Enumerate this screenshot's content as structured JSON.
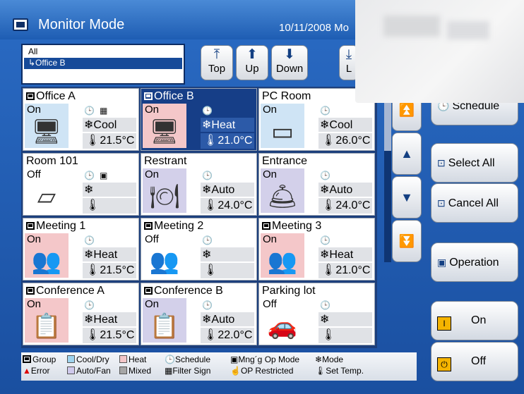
{
  "window": {
    "title": "Monitor Mode",
    "date": "10/11/2008 Mo"
  },
  "group_list": {
    "all": "All",
    "selected": "↳Office B"
  },
  "nav": {
    "top": "Top",
    "up": "Up",
    "down": "Down",
    "last": "L"
  },
  "units": [
    {
      "name": "Office A",
      "group": true,
      "status": "On",
      "status_color": "#cfe4f5",
      "art": "🖥",
      "schedule": "🕒",
      "filter": "▦",
      "mode": "Cool",
      "temp": "21.5°C",
      "selected": false
    },
    {
      "name": "Office B",
      "group": true,
      "status": "On",
      "status_color": "#f4c7c9",
      "art": "🖥",
      "schedule": "🕒",
      "filter": "",
      "mode": "Heat",
      "temp": "21.0°C",
      "selected": true
    },
    {
      "name": "PC Room",
      "group": false,
      "status": "On",
      "status_color": "#cfe4f5",
      "art": "▭",
      "schedule": "🕒",
      "filter": "",
      "mode": "Cool",
      "temp": "26.0°C",
      "selected": false
    },
    {
      "name": "Room 101",
      "group": false,
      "status": "Off",
      "status_color": "#ffffff",
      "art": "▱",
      "schedule": "🕒",
      "filter": "▣",
      "mode": "",
      "temp": "",
      "selected": false
    },
    {
      "name": "Restrant",
      "group": false,
      "status": "On",
      "status_color": "#d3d0ea",
      "art": "🍽",
      "schedule": "🕒",
      "filter": "",
      "mode": "Auto",
      "temp": "24.0°C",
      "selected": false
    },
    {
      "name": "Entrance",
      "group": false,
      "status": "On",
      "status_color": "#d3d0ea",
      "art": "🛎",
      "schedule": "🕒",
      "filter": "",
      "mode": "Auto",
      "temp": "24.0°C",
      "selected": false
    },
    {
      "name": "Meeting 1",
      "group": true,
      "status": "On",
      "status_color": "#f4c7c9",
      "art": "👥",
      "schedule": "🕒",
      "filter": "",
      "mode": "Heat",
      "temp": "21.5°C",
      "selected": false
    },
    {
      "name": "Meeting 2",
      "group": true,
      "status": "Off",
      "status_color": "#ffffff",
      "art": "👥",
      "schedule": "🕒",
      "filter": "",
      "mode": "",
      "temp": "",
      "selected": false
    },
    {
      "name": "Meeting 3",
      "group": true,
      "status": "On",
      "status_color": "#f4c7c9",
      "art": "👥",
      "schedule": "🕒",
      "filter": "",
      "mode": "Heat",
      "temp": "21.0°C",
      "selected": false
    },
    {
      "name": "Conference A",
      "group": true,
      "status": "On",
      "status_color": "#f4c7c9",
      "art": "📋",
      "schedule": "🕒",
      "filter": "",
      "mode": "Heat",
      "temp": "21.5°C",
      "selected": false
    },
    {
      "name": "Conference B",
      "group": true,
      "status": "On",
      "status_color": "#d3d0ea",
      "art": "📋",
      "schedule": "🕒",
      "filter": "",
      "mode": "Auto",
      "temp": "22.0°C",
      "selected": false
    },
    {
      "name": "Parking lot",
      "group": false,
      "status": "Off",
      "status_color": "#ffffff",
      "art": "🚗",
      "schedule": "🕒",
      "filter": "",
      "mode": "",
      "temp": "",
      "selected": false
    }
  ],
  "side": {
    "schedule": "Schedule",
    "select_all": "Select All",
    "cancel_all": "Cancel All",
    "operation": "Operation",
    "on": "On",
    "off": "Off"
  },
  "legend": {
    "group": "Group",
    "error": "Error",
    "cool_dry": "Cool/Dry",
    "auto_fan": "Auto/Fan",
    "heat": "Heat",
    "mixed": "Mixed",
    "schedule": "Schedule",
    "filter_sign": "Filter Sign",
    "mng_op_mode": "Mng´g Op Mode",
    "op_restricted": "OP Restricted",
    "mode": "Mode",
    "set_temp": "Set Temp."
  },
  "colors": {
    "cool": "#cfe4f5",
    "heat": "#f4c7c9",
    "auto": "#d3d0ea",
    "mixed": "#a6a6a6",
    "selected": "#163e87"
  }
}
